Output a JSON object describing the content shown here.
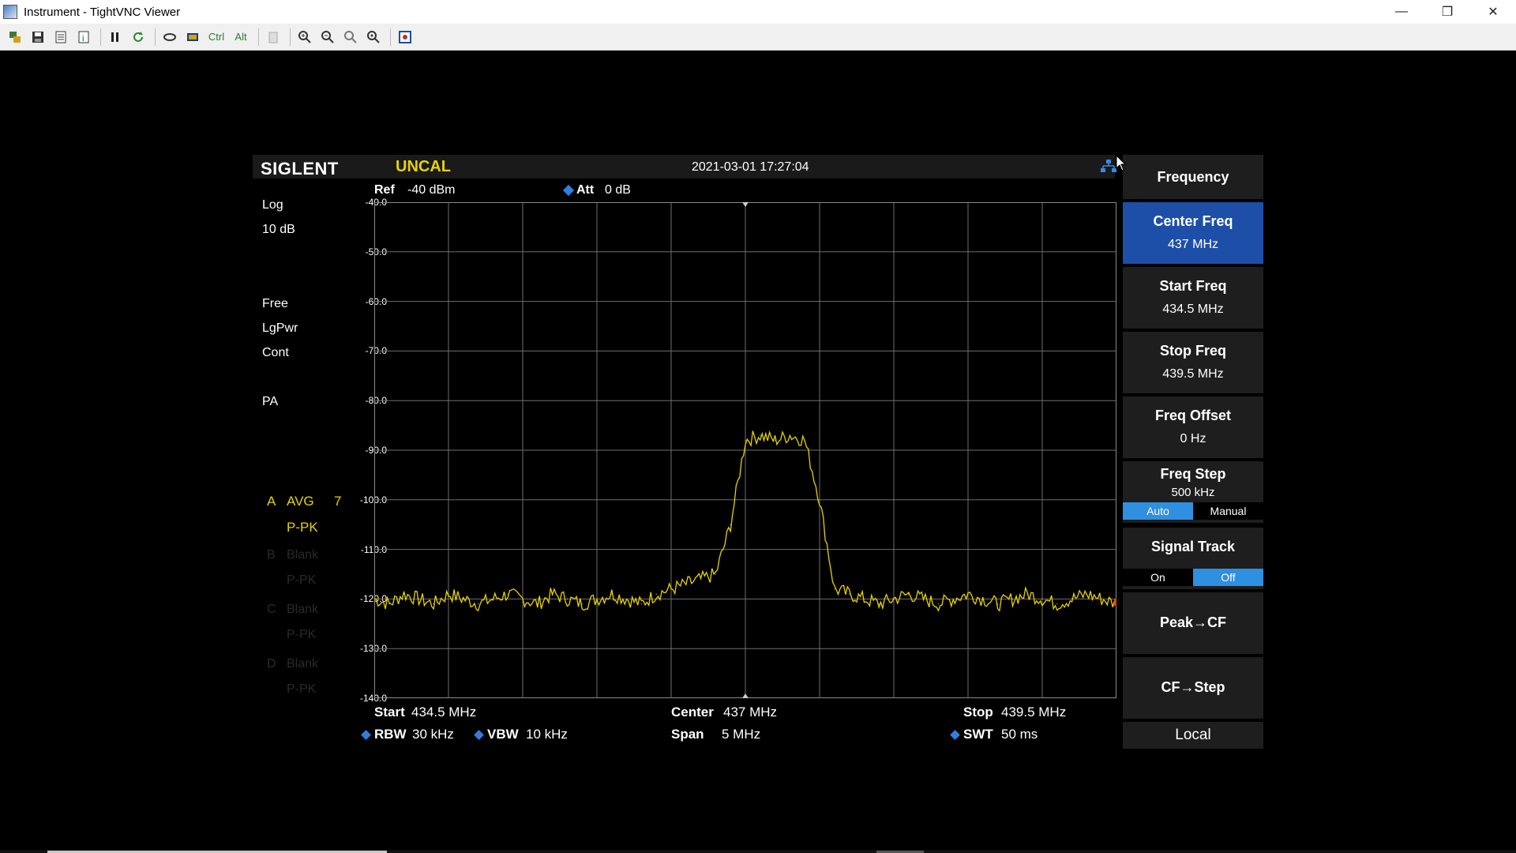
{
  "window": {
    "title": "Instrument - TightVNC Viewer",
    "minimize": "—",
    "maximize": "❐",
    "close": "✕"
  },
  "toolbar": {
    "items": [
      "new-connection",
      "save",
      "options",
      "info",
      "pause",
      "refresh",
      "transfer",
      "fullscreen",
      "ctrl",
      "alt",
      "clipboard",
      "zoom-in",
      "zoom-out",
      "zoom-fit",
      "zoom-custom",
      "scale"
    ],
    "ctrl_label": "Ctrl",
    "alt_label": "Alt"
  },
  "instrument": {
    "brand": "SIGLENT",
    "status": "UNCAL",
    "datetime": "2021-03-01 17:27:04",
    "ref_label": "Ref",
    "ref_value": "-40 dBm",
    "att_label": "Att",
    "att_value": "0 dB",
    "left_panel": {
      "scale_type": "Log",
      "scale_div": "10 dB",
      "trigger": "Free",
      "detector_mode": "LgPwr",
      "sweep_mode": "Cont",
      "preamp": "PA",
      "trace_a_letter": "A",
      "trace_a_mode": "AVG",
      "trace_a_count": "7",
      "trace_a_detector": "P-PK",
      "trace_b_letter": "B",
      "trace_b_mode": "Blank",
      "trace_b_detector": "P-PK",
      "trace_c_letter": "C",
      "trace_c_mode": "Blank",
      "trace_c_detector": "P-PK",
      "trace_d_letter": "D",
      "trace_d_mode": "Blank",
      "trace_d_detector": "P-PK"
    },
    "y_ticks": [
      "-40.0",
      "-50.0",
      "-60.0",
      "-70.0",
      "-80.0",
      "-90.0",
      "-100.0",
      "-110.0",
      "-120.0",
      "-130.0",
      "-140.0"
    ],
    "bottom": {
      "start_label": "Start",
      "start_value": "434.5 MHz",
      "center_label": "Center",
      "center_value": "437 MHz",
      "stop_label": "Stop",
      "stop_value": "439.5 MHz",
      "rbw_label": "RBW",
      "rbw_value": "30 kHz",
      "vbw_label": "VBW",
      "vbw_value": "10 kHz",
      "span_label": "Span",
      "span_value": "5 MHz",
      "swt_label": "SWT",
      "swt_value": "50 ms"
    },
    "menu": {
      "title": "Frequency",
      "center_freq_label": "Center Freq",
      "center_freq_value": "437 MHz",
      "start_freq_label": "Start Freq",
      "start_freq_value": "434.5 MHz",
      "stop_freq_label": "Stop Freq",
      "stop_freq_value": "439.5 MHz",
      "freq_offset_label": "Freq Offset",
      "freq_offset_value": "0 Hz",
      "freq_step_label": "Freq Step",
      "freq_step_value": "500 kHz",
      "freq_step_auto": "Auto",
      "freq_step_manual": "Manual",
      "signal_track_label": "Signal Track",
      "signal_track_on": "On",
      "signal_track_off": "Off",
      "peak_cf_label": "Peak→CF",
      "cf_step_label": "CF→Step",
      "local_label": "Local"
    }
  },
  "chart_data": {
    "type": "line",
    "title": "",
    "xlabel": "",
    "ylabel": "",
    "xlim": [
      434.5,
      439.5
    ],
    "ylim": [
      -140,
      -40
    ],
    "y_scale_div_db": 10,
    "color": "#e6d200",
    "grid": true,
    "series": [
      {
        "x": [
          434.5,
          434.6,
          434.7,
          434.8,
          434.9,
          435.0,
          435.1,
          435.2,
          435.3,
          435.4,
          435.5,
          435.6,
          435.7,
          435.8,
          435.9,
          436.0,
          436.1,
          436.2,
          436.3,
          436.4,
          436.5,
          436.6,
          436.7,
          436.8,
          436.9,
          437.0,
          437.1,
          437.2,
          437.3,
          437.4,
          437.5,
          437.6,
          437.7,
          437.8,
          437.9,
          438.0,
          438.1,
          438.2,
          438.3,
          438.4,
          438.5,
          438.6,
          438.7,
          438.8,
          438.9,
          439.0,
          439.1,
          439.2,
          439.3,
          439.4,
          439.5
        ],
        "y": [
          -120,
          -121,
          -119,
          -120,
          -121,
          -119,
          -120,
          -121,
          -120,
          -119,
          -120,
          -121,
          -119,
          -120,
          -121,
          -120,
          -119,
          -120,
          -121,
          -119,
          -118,
          -117,
          -116,
          -115,
          -105,
          -88,
          -87,
          -88,
          -87,
          -88,
          -100,
          -118,
          -119,
          -120,
          -121,
          -120,
          -119,
          -120,
          -121,
          -120,
          -119,
          -120,
          -121,
          -120,
          -119,
          -120,
          -121,
          -120,
          -119,
          -120,
          -121
        ]
      }
    ]
  }
}
